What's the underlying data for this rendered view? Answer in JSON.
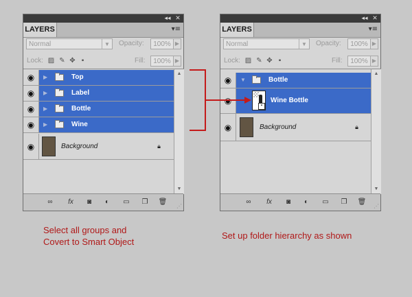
{
  "left_panel": {
    "tab": "LAYERS",
    "blend_mode": "Normal",
    "opacity_label": "Opacity:",
    "opacity_value": "100%",
    "lock_label": "Lock:",
    "fill_label": "Fill:",
    "fill_value": "100%",
    "layers": [
      {
        "name": "Top",
        "type": "group",
        "selected": true
      },
      {
        "name": "Label",
        "type": "group",
        "selected": true
      },
      {
        "name": "Bottle",
        "type": "group",
        "selected": true
      },
      {
        "name": "Wine",
        "type": "group",
        "selected": true
      },
      {
        "name": "Background",
        "type": "background",
        "selected": false
      }
    ]
  },
  "right_panel": {
    "tab": "LAYERS",
    "blend_mode": "Normal",
    "opacity_label": "Opacity:",
    "opacity_value": "100%",
    "lock_label": "Lock:",
    "fill_label": "Fill:",
    "fill_value": "100%",
    "layers": [
      {
        "name": "Bottle",
        "type": "group-expanded",
        "selected": true
      },
      {
        "name": "Wine Bottle",
        "type": "smart-object",
        "selected": true
      },
      {
        "name": "Background",
        "type": "background",
        "selected": false
      }
    ]
  },
  "captions": {
    "left_line1": "Select all groups and",
    "left_line2": "Covert to Smart Object",
    "right": "Set up folder hierarchy as shown"
  },
  "titlebar": {
    "collapse": "◂◂",
    "close": "✕"
  },
  "panel_menu_icon": "▾≡",
  "colors": {
    "selection": "#3b6ac8",
    "caption": "#b01818",
    "connector": "#c41a1a",
    "background_swatch": "#625543"
  }
}
